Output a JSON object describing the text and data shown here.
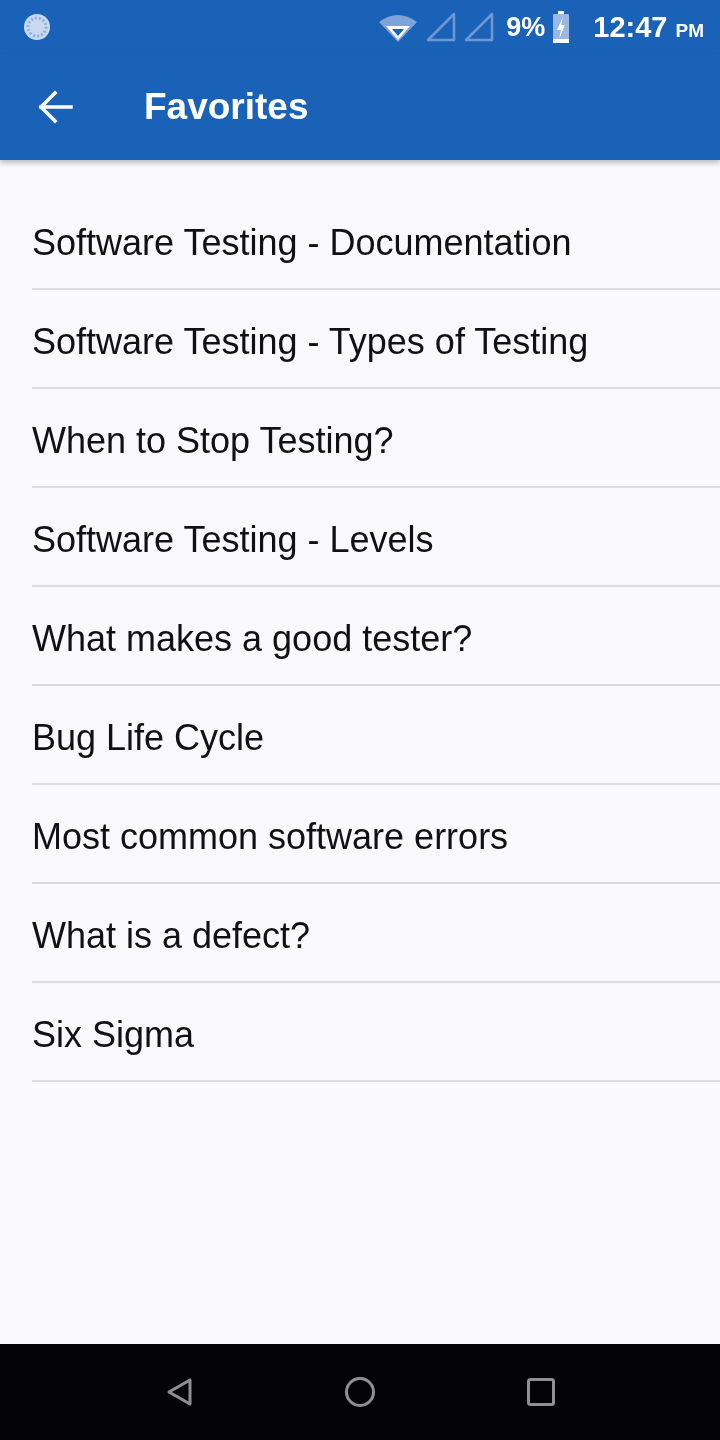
{
  "status_bar": {
    "battery": "9%",
    "time": "12:47",
    "time_suffix": "PM"
  },
  "app_bar": {
    "title": "Favorites"
  },
  "favorites": [
    {
      "title": "Software Testing - Documentation"
    },
    {
      "title": "Software Testing - Types of Testing"
    },
    {
      "title": "When to Stop Testing?"
    },
    {
      "title": "Software Testing - Levels"
    },
    {
      "title": "What makes a good tester?"
    },
    {
      "title": "Bug Life Cycle"
    },
    {
      "title": "Most common software errors"
    },
    {
      "title": "What is a defect?"
    },
    {
      "title": "Six Sigma"
    }
  ]
}
